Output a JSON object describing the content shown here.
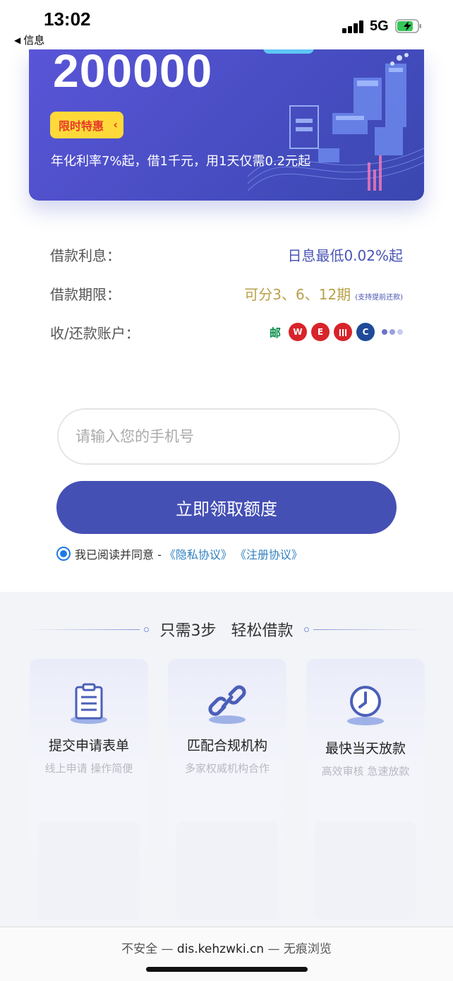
{
  "status_bar": {
    "time": "13:02",
    "back_label": "信息",
    "network": "5G"
  },
  "banner": {
    "amount": "200000",
    "tag": "限时特惠",
    "description": "年化利率7%起，借1千元，用1天仅需0.2元起"
  },
  "info": {
    "interest_label": "借款利息：",
    "interest_value": "日息最低0.02%起",
    "term_label": "借款期限：",
    "term_value": "可分3、6、12期",
    "term_note": "(支持提前还款)",
    "account_label": "收/还款账户：",
    "banks": [
      {
        "name": "postal-savings-bank-icon",
        "color": "#0a8f4b",
        "glyph": "邮"
      },
      {
        "name": "bank-w-icon",
        "color": "#d8232a",
        "glyph": "W"
      },
      {
        "name": "bank-e-icon",
        "color": "#d8232a",
        "glyph": "E"
      },
      {
        "name": "industrial-bank-icon",
        "color": "#d8232a",
        "glyph": "ǀǀǀ"
      },
      {
        "name": "construction-bank-icon",
        "color": "#1f4a99",
        "glyph": "C"
      }
    ]
  },
  "form": {
    "phone_placeholder": "请输入您的手机号",
    "submit_label": "立即领取额度",
    "agree_text": "我已阅读并同意 -",
    "privacy_link": "《隐私协议》",
    "register_link": "《注册协议》"
  },
  "steps": {
    "title": "只需3步   轻松借款",
    "cards": [
      {
        "name": "提交申请表单",
        "sub": "线上申请 操作简便"
      },
      {
        "name": "匹配合规机构",
        "sub": "多家权威机构合作"
      },
      {
        "name": "最快当天放款",
        "sub": "高效审核 急速放款"
      }
    ]
  },
  "url_bar": {
    "prefix": "不安全 — ",
    "domain": "dis.kehzwki.cn",
    "suffix": " — 无痕浏览"
  }
}
